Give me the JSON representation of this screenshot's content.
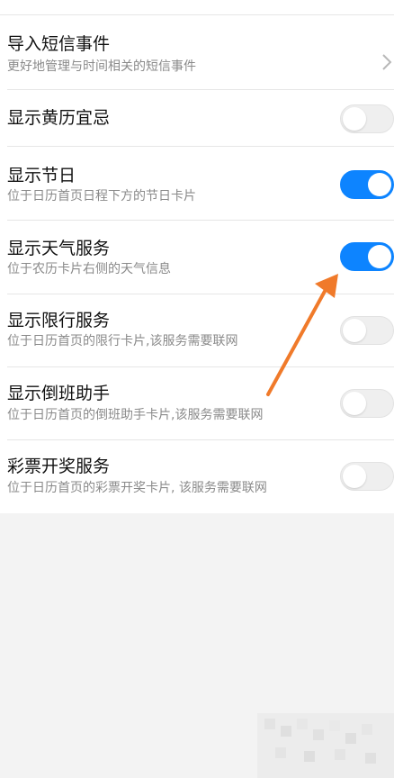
{
  "settings": {
    "items": [
      {
        "title": "导入短信事件",
        "subtitle": "更好地管理与时间相关的短信事件",
        "control": "chevron"
      },
      {
        "title": "显示黄历宜忌",
        "subtitle": "",
        "control": "toggle",
        "enabled": false
      },
      {
        "title": "显示节日",
        "subtitle": "位于日历首页日程下方的节日卡片",
        "control": "toggle",
        "enabled": true
      },
      {
        "title": "显示天气服务",
        "subtitle": "位于农历卡片右侧的天气信息",
        "control": "toggle",
        "enabled": true
      },
      {
        "title": "显示限行服务",
        "subtitle": "位于日历首页的限行卡片,该服务需要联网",
        "control": "toggle",
        "enabled": false
      },
      {
        "title": "显示倒班助手",
        "subtitle": "位于日历首页的倒班助手卡片,该服务需要联网",
        "control": "toggle",
        "enabled": false
      },
      {
        "title": "彩票开奖服务",
        "subtitle": "位于日历首页的彩票开奖卡片, 该服务需要联网",
        "control": "toggle",
        "enabled": false
      }
    ]
  },
  "theme": {
    "toggle_on": "#0d84ff",
    "annotation_arrow": "#f07a2a"
  },
  "icons": {
    "chevron": "chevron-right-icon",
    "arrow": "annotation-arrow-icon"
  }
}
